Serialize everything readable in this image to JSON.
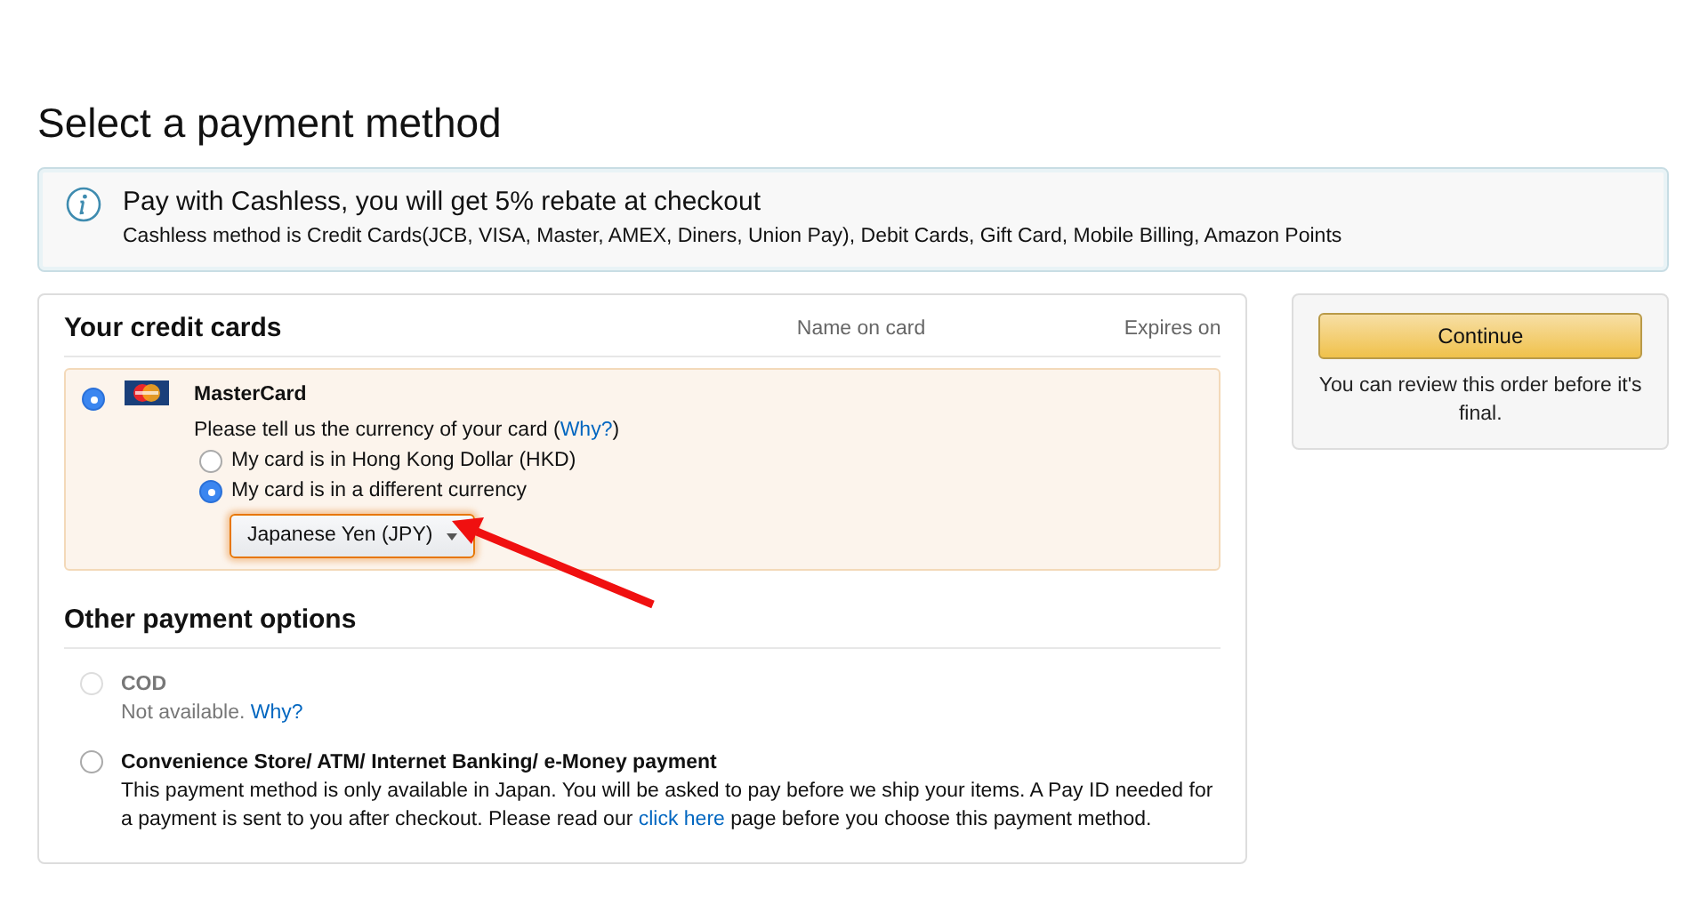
{
  "title": "Select a payment method",
  "notice": {
    "heading": "Pay with Cashless, you will get 5% rebate at checkout",
    "text": "Cashless method is Credit Cards(JCB, VISA, Master, AMEX, Diners, Union Pay), Debit Cards, Gift Card, Mobile Billing, Amazon Points"
  },
  "cards": {
    "heading": "Your credit cards",
    "columns": [
      "Name on card",
      "Expires on"
    ],
    "items": [
      {
        "name": "MasterCard",
        "selected": true,
        "prompt": "Please tell us the currency of your card (",
        "prompt_link": "Why?",
        "prompt_end": ")",
        "currency_options": [
          {
            "label": "My card is in Hong Kong Dollar (HKD)",
            "selected": false
          },
          {
            "label": "My card is in a different currency",
            "selected": true
          }
        ],
        "currency": "Japanese Yen (JPY)"
      }
    ]
  },
  "other": {
    "heading": "Other payment options",
    "options": [
      {
        "name": "COD",
        "selected": false,
        "disabled": true,
        "note": "Not available. ",
        "link": "Why?"
      },
      {
        "name": "Convenience Store/ ATM/ Internet Banking/ e-Money payment",
        "selected": false,
        "disabled": false,
        "note": "This payment method is only available in Japan. You will be asked to pay before we ship your items. A Pay ID needed for a payment is sent to you after checkout. Please read our ",
        "link": "click here",
        "note_end": " page before you choose this payment method."
      }
    ]
  },
  "side": {
    "button": "Continue",
    "note": "You can review this order before it's final."
  }
}
